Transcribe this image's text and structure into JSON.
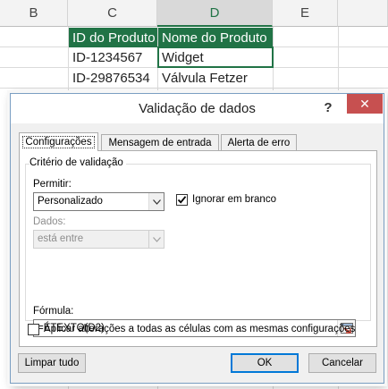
{
  "sheet": {
    "columns": [
      "B",
      "C",
      "D",
      "E"
    ],
    "selected_column": "D",
    "headers": [
      "ID do Produto",
      "Nome do Produto"
    ],
    "rows": [
      [
        "ID-1234567",
        "Widget"
      ],
      [
        "ID-29876534",
        "Válvula Fetzer"
      ]
    ],
    "colors": {
      "header_fill": "#217346",
      "selection_border": "#217346"
    }
  },
  "dialog": {
    "title": "Validação de dados",
    "help_label": "?",
    "close_icon": "close-icon",
    "tabs": [
      {
        "label": "Configurações",
        "active": true
      },
      {
        "label": "Mensagem de entrada",
        "active": false
      },
      {
        "label": "Alerta de erro",
        "active": false
      }
    ],
    "criteria_label": "Critério de validação",
    "allow": {
      "label": "Permitir:",
      "value": "Personalizado"
    },
    "ignore_blank": {
      "label": "Ignorar em branco",
      "checked": true
    },
    "data": {
      "label": "Dados:",
      "value": "está entre",
      "disabled": true
    },
    "formula": {
      "label": "Fórmula:",
      "value": "=ÉTEXTO(D2)"
    },
    "apply_all": {
      "label": "Aplicar alterações a todas as células com as mesmas configurações",
      "checked": false
    },
    "buttons": {
      "clear": "Limpar tudo",
      "ok": "OK",
      "cancel": "Cancelar"
    }
  }
}
